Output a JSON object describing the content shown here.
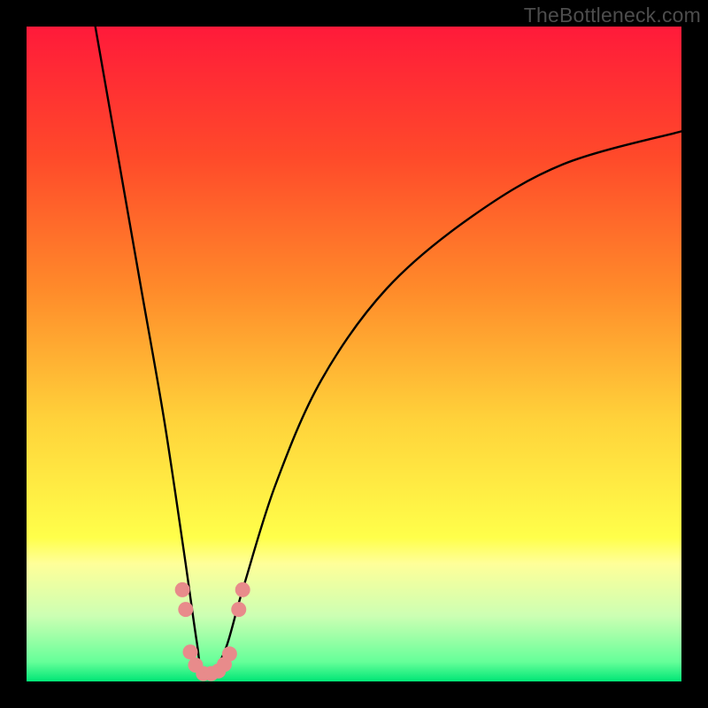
{
  "watermark": "TheBottleneck.com",
  "chart_data": {
    "type": "line",
    "title": "",
    "xlabel": "",
    "ylabel": "",
    "x_range": [
      0,
      100
    ],
    "y_range": [
      0,
      100
    ],
    "background_gradient_stops": [
      {
        "pos": 0.0,
        "color": "#ff1a3a"
      },
      {
        "pos": 0.2,
        "color": "#ff4a2a"
      },
      {
        "pos": 0.4,
        "color": "#ff8a2a"
      },
      {
        "pos": 0.6,
        "color": "#ffd23a"
      },
      {
        "pos": 0.78,
        "color": "#ffff4a"
      },
      {
        "pos": 0.82,
        "color": "#ffff99"
      },
      {
        "pos": 0.9,
        "color": "#ccffb3"
      },
      {
        "pos": 0.97,
        "color": "#66ff99"
      },
      {
        "pos": 1.0,
        "color": "#00e676"
      }
    ],
    "curve": {
      "description": "V-shaped bottleneck curve: steep left branch falls from top-left to a minimum near x≈27, then rises with decreasing slope toward top-right",
      "minimum_x": 27,
      "minimum_y": 1,
      "left_branch": [
        {
          "x": 10.5,
          "y": 100
        },
        {
          "x": 14.0,
          "y": 80
        },
        {
          "x": 17.5,
          "y": 60
        },
        {
          "x": 21.0,
          "y": 40
        },
        {
          "x": 24.0,
          "y": 20
        },
        {
          "x": 26.0,
          "y": 6
        },
        {
          "x": 27.0,
          "y": 1
        }
      ],
      "right_branch": [
        {
          "x": 27.0,
          "y": 1
        },
        {
          "x": 30.0,
          "y": 4
        },
        {
          "x": 33.0,
          "y": 14
        },
        {
          "x": 38.0,
          "y": 30
        },
        {
          "x": 45.0,
          "y": 46
        },
        {
          "x": 55.0,
          "y": 60
        },
        {
          "x": 68.0,
          "y": 71
        },
        {
          "x": 82.0,
          "y": 79
        },
        {
          "x": 100.0,
          "y": 84
        }
      ]
    },
    "markers": {
      "color": "#e88b8b",
      "points": [
        {
          "x": 23.8,
          "y": 14
        },
        {
          "x": 24.3,
          "y": 11
        },
        {
          "x": 25.0,
          "y": 4.5
        },
        {
          "x": 25.8,
          "y": 2.5
        },
        {
          "x": 27.0,
          "y": 1.2
        },
        {
          "x": 28.2,
          "y": 1.2
        },
        {
          "x": 29.3,
          "y": 1.6
        },
        {
          "x": 30.2,
          "y": 2.6
        },
        {
          "x": 31.0,
          "y": 4.2
        },
        {
          "x": 32.4,
          "y": 11
        },
        {
          "x": 33.0,
          "y": 14
        }
      ]
    }
  }
}
